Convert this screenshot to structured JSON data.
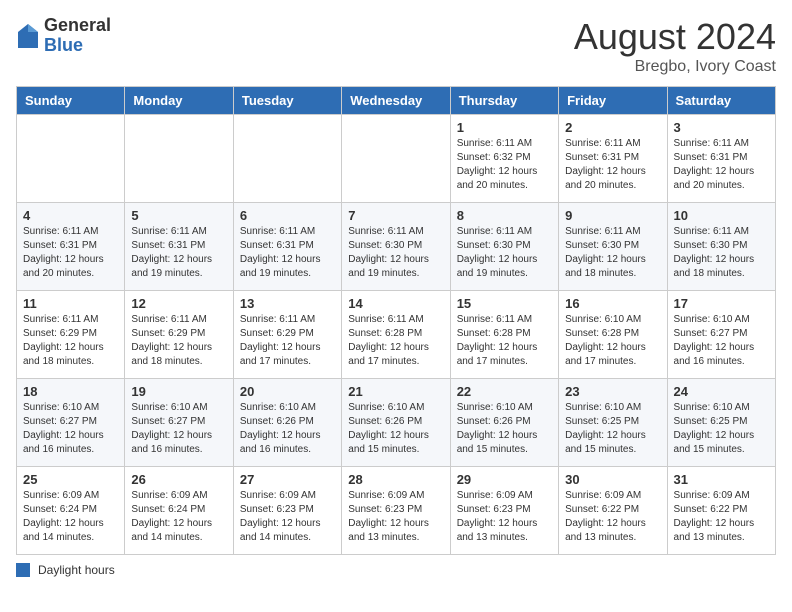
{
  "header": {
    "logo_general": "General",
    "logo_blue": "Blue",
    "month_year": "August 2024",
    "location": "Bregbo, Ivory Coast"
  },
  "days_of_week": [
    "Sunday",
    "Monday",
    "Tuesday",
    "Wednesday",
    "Thursday",
    "Friday",
    "Saturday"
  ],
  "footer": {
    "label": "Daylight hours"
  },
  "weeks": [
    [
      {
        "day": "",
        "detail": ""
      },
      {
        "day": "",
        "detail": ""
      },
      {
        "day": "",
        "detail": ""
      },
      {
        "day": "",
        "detail": ""
      },
      {
        "day": "1",
        "detail": "Sunrise: 6:11 AM\nSunset: 6:32 PM\nDaylight: 12 hours\nand 20 minutes."
      },
      {
        "day": "2",
        "detail": "Sunrise: 6:11 AM\nSunset: 6:31 PM\nDaylight: 12 hours\nand 20 minutes."
      },
      {
        "day": "3",
        "detail": "Sunrise: 6:11 AM\nSunset: 6:31 PM\nDaylight: 12 hours\nand 20 minutes."
      }
    ],
    [
      {
        "day": "4",
        "detail": "Sunrise: 6:11 AM\nSunset: 6:31 PM\nDaylight: 12 hours\nand 20 minutes."
      },
      {
        "day": "5",
        "detail": "Sunrise: 6:11 AM\nSunset: 6:31 PM\nDaylight: 12 hours\nand 19 minutes."
      },
      {
        "day": "6",
        "detail": "Sunrise: 6:11 AM\nSunset: 6:31 PM\nDaylight: 12 hours\nand 19 minutes."
      },
      {
        "day": "7",
        "detail": "Sunrise: 6:11 AM\nSunset: 6:30 PM\nDaylight: 12 hours\nand 19 minutes."
      },
      {
        "day": "8",
        "detail": "Sunrise: 6:11 AM\nSunset: 6:30 PM\nDaylight: 12 hours\nand 19 minutes."
      },
      {
        "day": "9",
        "detail": "Sunrise: 6:11 AM\nSunset: 6:30 PM\nDaylight: 12 hours\nand 18 minutes."
      },
      {
        "day": "10",
        "detail": "Sunrise: 6:11 AM\nSunset: 6:30 PM\nDaylight: 12 hours\nand 18 minutes."
      }
    ],
    [
      {
        "day": "11",
        "detail": "Sunrise: 6:11 AM\nSunset: 6:29 PM\nDaylight: 12 hours\nand 18 minutes."
      },
      {
        "day": "12",
        "detail": "Sunrise: 6:11 AM\nSunset: 6:29 PM\nDaylight: 12 hours\nand 18 minutes."
      },
      {
        "day": "13",
        "detail": "Sunrise: 6:11 AM\nSunset: 6:29 PM\nDaylight: 12 hours\nand 17 minutes."
      },
      {
        "day": "14",
        "detail": "Sunrise: 6:11 AM\nSunset: 6:28 PM\nDaylight: 12 hours\nand 17 minutes."
      },
      {
        "day": "15",
        "detail": "Sunrise: 6:11 AM\nSunset: 6:28 PM\nDaylight: 12 hours\nand 17 minutes."
      },
      {
        "day": "16",
        "detail": "Sunrise: 6:10 AM\nSunset: 6:28 PM\nDaylight: 12 hours\nand 17 minutes."
      },
      {
        "day": "17",
        "detail": "Sunrise: 6:10 AM\nSunset: 6:27 PM\nDaylight: 12 hours\nand 16 minutes."
      }
    ],
    [
      {
        "day": "18",
        "detail": "Sunrise: 6:10 AM\nSunset: 6:27 PM\nDaylight: 12 hours\nand 16 minutes."
      },
      {
        "day": "19",
        "detail": "Sunrise: 6:10 AM\nSunset: 6:27 PM\nDaylight: 12 hours\nand 16 minutes."
      },
      {
        "day": "20",
        "detail": "Sunrise: 6:10 AM\nSunset: 6:26 PM\nDaylight: 12 hours\nand 16 minutes."
      },
      {
        "day": "21",
        "detail": "Sunrise: 6:10 AM\nSunset: 6:26 PM\nDaylight: 12 hours\nand 15 minutes."
      },
      {
        "day": "22",
        "detail": "Sunrise: 6:10 AM\nSunset: 6:26 PM\nDaylight: 12 hours\nand 15 minutes."
      },
      {
        "day": "23",
        "detail": "Sunrise: 6:10 AM\nSunset: 6:25 PM\nDaylight: 12 hours\nand 15 minutes."
      },
      {
        "day": "24",
        "detail": "Sunrise: 6:10 AM\nSunset: 6:25 PM\nDaylight: 12 hours\nand 15 minutes."
      }
    ],
    [
      {
        "day": "25",
        "detail": "Sunrise: 6:09 AM\nSunset: 6:24 PM\nDaylight: 12 hours\nand 14 minutes."
      },
      {
        "day": "26",
        "detail": "Sunrise: 6:09 AM\nSunset: 6:24 PM\nDaylight: 12 hours\nand 14 minutes."
      },
      {
        "day": "27",
        "detail": "Sunrise: 6:09 AM\nSunset: 6:23 PM\nDaylight: 12 hours\nand 14 minutes."
      },
      {
        "day": "28",
        "detail": "Sunrise: 6:09 AM\nSunset: 6:23 PM\nDaylight: 12 hours\nand 13 minutes."
      },
      {
        "day": "29",
        "detail": "Sunrise: 6:09 AM\nSunset: 6:23 PM\nDaylight: 12 hours\nand 13 minutes."
      },
      {
        "day": "30",
        "detail": "Sunrise: 6:09 AM\nSunset: 6:22 PM\nDaylight: 12 hours\nand 13 minutes."
      },
      {
        "day": "31",
        "detail": "Sunrise: 6:09 AM\nSunset: 6:22 PM\nDaylight: 12 hours\nand 13 minutes."
      }
    ]
  ]
}
